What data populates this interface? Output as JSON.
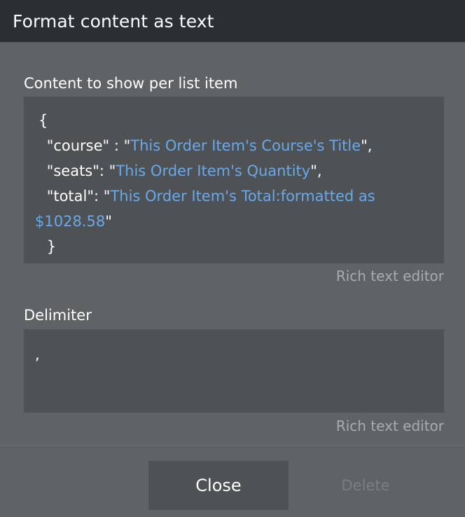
{
  "dialog": {
    "title": "Format content as text",
    "content_label": "Content to show per list item",
    "content_editor": {
      "line1": "{",
      "line2_prefix": " \"course\" : \"",
      "line2_dynamic": "This Order Item's Course's Title",
      "line2_suffix": "\",",
      "line3_prefix": " \"seats\": \"",
      "line3_dynamic": "This Order Item's Quantity",
      "line3_suffix": "\",",
      "line4_prefix": " \"total\": \"",
      "line4_dynamic": "This Order Item's Total:formatted as",
      "line5_dynamic": "$1028.58",
      "line5_suffix": "\"",
      "line6": " }"
    },
    "content_rte_label": "Rich text editor",
    "delimiter_label": "Delimiter",
    "delimiter_value": ",",
    "delimiter_rte_label": "Rich text editor",
    "close_label": "Close",
    "delete_label": "Delete"
  },
  "colors": {
    "background": "#5f6366",
    "titlebar": "#2a2f33",
    "editor_bg": "#4e5255",
    "dynamic_text": "#6aa8e8",
    "muted_text": "#a8acaf",
    "disabled_text": "#7a7e81"
  }
}
